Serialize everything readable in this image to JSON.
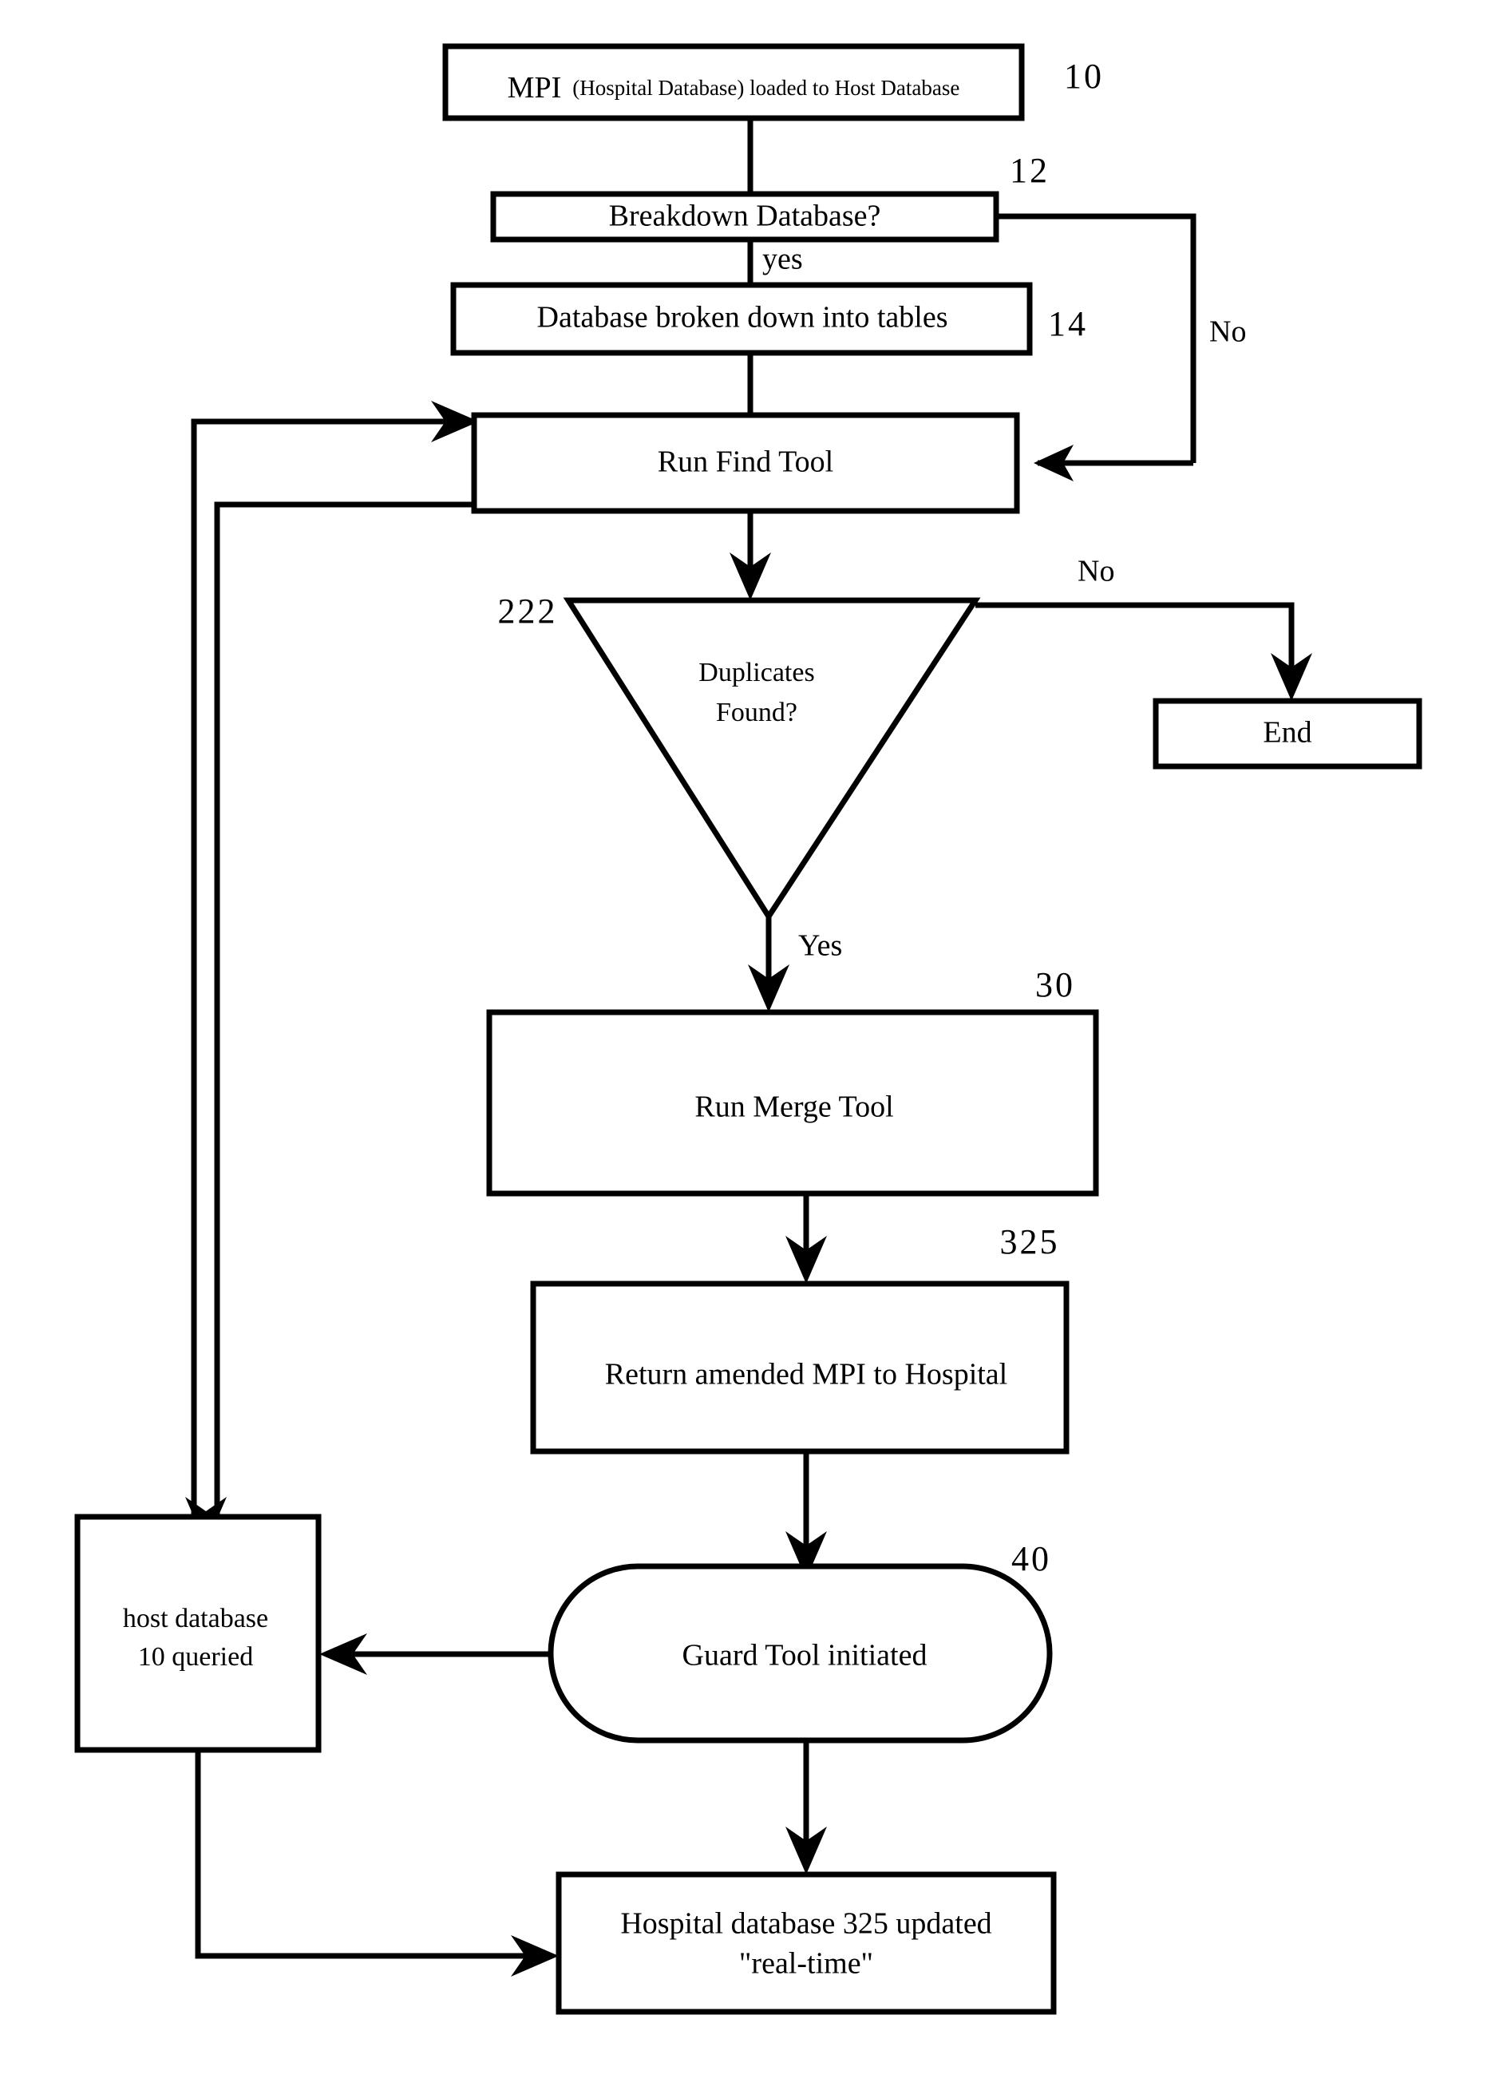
{
  "diagram": {
    "title": "MPI duplicate detection and merge process flowchart",
    "nodes": {
      "load_mpi": {
        "label_main": "MPI",
        "label_small": "(Hospital Database) loaded to Host Database",
        "ref": "10"
      },
      "breakdown_db": {
        "label": "Breakdown Database?",
        "ref": "12"
      },
      "broken_tables": {
        "label": "Database broken down into tables",
        "ref": "14"
      },
      "run_find": {
        "label": "Run Find Tool",
        "ref": ""
      },
      "duplicates": {
        "label_line1": "Duplicates",
        "label_line2": "Found?",
        "ref": "222"
      },
      "end": {
        "label": "End",
        "ref": ""
      },
      "run_merge": {
        "label": "Run Merge Tool",
        "ref": "30"
      },
      "return_mpi": {
        "label": "Return amended MPI to Hospital",
        "ref": "325"
      },
      "guard_tool": {
        "label": "Guard Tool initiated",
        "ref": "40"
      },
      "host_db": {
        "label_line1": "host database",
        "label_line2": "10 queried",
        "ref": ""
      },
      "hospital_updated": {
        "label_line1": "Hospital database 325 updated",
        "label_line2": "\"real-time\"",
        "ref": ""
      }
    },
    "edge_labels": {
      "breakdown_yes": "yes",
      "breakdown_no": "No",
      "duplicates_no": "No",
      "duplicates_yes": "Yes"
    },
    "colors": {
      "stroke": "#000000",
      "fill": "#ffffff",
      "text": "#000000"
    }
  }
}
